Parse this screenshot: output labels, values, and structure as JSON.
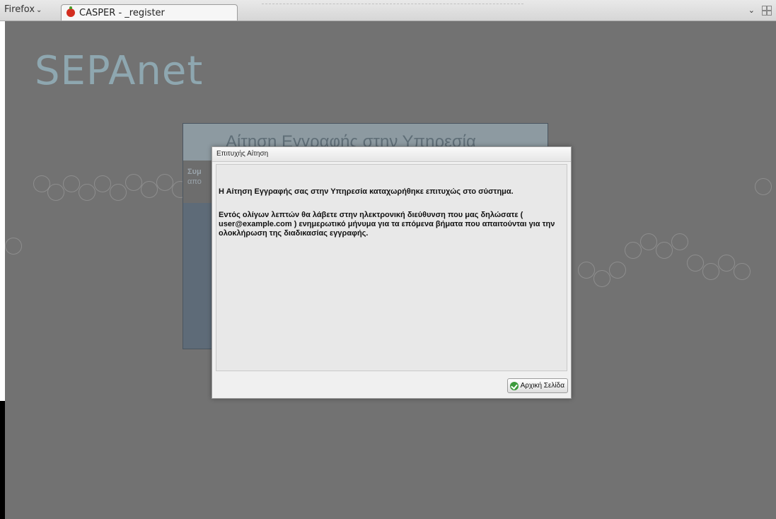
{
  "browser": {
    "menu_label": "Firefox",
    "menu_chevron": "⌄",
    "tab_title": "CASPER - _register",
    "list_tabs_icon": "⌄"
  },
  "page": {
    "logo": "SEPAnet",
    "background_card": {
      "title": "Αίτηση Εγγραφής στην Υπηρεσία",
      "text1": "Συμ",
      "text2": "απο"
    }
  },
  "dialog": {
    "title": "Επιτυχής Αίτηση",
    "message_line1": "Η Αίτηση Εγγραφής σας στην Υπηρεσία καταχωρήθηκε επιτυχώς στο σύστημα.",
    "message_paragraph": "Εντός ολίγων λεπτών θα λάβετε στην ηλεκτρονική διεύθυνση που μας δηλώσατε ( user@example.com ) ενημερωτικό μήνυμα για τα επόμενα βήματα που απαιτούνται για την ολοκλήρωση της διαδικασίας εγγραφής.",
    "home_button_label": "Αρχική Σελίδα"
  },
  "colors": {
    "page_bg": "#727272",
    "logo": "#8ea7b0",
    "card_header": "#8d9aa1",
    "card_body": "#5e6b78",
    "button_icon": "#3c9a3c"
  },
  "icons": {
    "favicon": "casper-strawberry-icon",
    "button": "green-check-icon",
    "tab_groups": "tab-groups-icon"
  }
}
